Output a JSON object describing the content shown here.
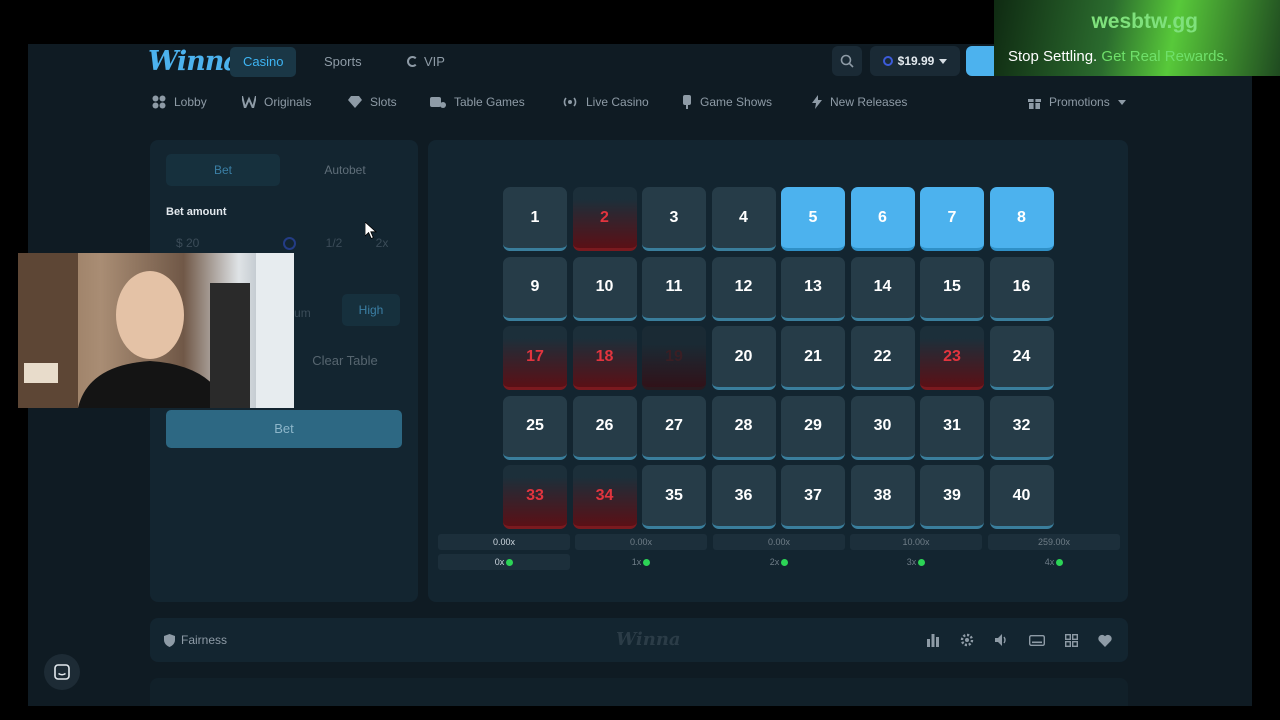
{
  "brand": {
    "logo": "Winna"
  },
  "nav": {
    "tabs": [
      {
        "label": "Casino",
        "active": true
      },
      {
        "label": "Sports",
        "active": false
      },
      {
        "label": "VIP",
        "active": false
      }
    ],
    "balance": "$19.99"
  },
  "categories": [
    {
      "label": "Lobby",
      "icon": "grid-icon"
    },
    {
      "label": "Originals",
      "icon": "originals-icon"
    },
    {
      "label": "Slots",
      "icon": "diamond-icon"
    },
    {
      "label": "Table Games",
      "icon": "table-icon"
    },
    {
      "label": "Live Casino",
      "icon": "live-icon"
    },
    {
      "label": "Game Shows",
      "icon": "mic-icon"
    },
    {
      "label": "New Releases",
      "icon": "bolt-icon"
    },
    {
      "label": "Promotions",
      "icon": "gift-icon"
    }
  ],
  "bet_panel": {
    "tabs": [
      {
        "label": "Bet",
        "active": true
      },
      {
        "label": "Autobet",
        "active": false
      }
    ],
    "amount_label": "Bet amount",
    "amount_value": "$ 20",
    "half": "1/2",
    "double": "2x",
    "risk_medium": "edium",
    "risk_high": "High",
    "clear_label": "Clear Table",
    "bet_label": "Bet"
  },
  "keno": {
    "tiles": [
      {
        "n": "1",
        "s": "normal"
      },
      {
        "n": "2",
        "s": "miss"
      },
      {
        "n": "3",
        "s": "normal"
      },
      {
        "n": "4",
        "s": "normal"
      },
      {
        "n": "5",
        "s": "picked"
      },
      {
        "n": "6",
        "s": "picked"
      },
      {
        "n": "7",
        "s": "picked"
      },
      {
        "n": "8",
        "s": "picked"
      },
      {
        "n": "9",
        "s": "normal"
      },
      {
        "n": "10",
        "s": "normal"
      },
      {
        "n": "11",
        "s": "normal"
      },
      {
        "n": "12",
        "s": "normal"
      },
      {
        "n": "13",
        "s": "normal"
      },
      {
        "n": "14",
        "s": "normal"
      },
      {
        "n": "15",
        "s": "normal"
      },
      {
        "n": "16",
        "s": "normal"
      },
      {
        "n": "17",
        "s": "miss"
      },
      {
        "n": "18",
        "s": "miss"
      },
      {
        "n": "19",
        "s": "faded"
      },
      {
        "n": "20",
        "s": "normal"
      },
      {
        "n": "21",
        "s": "normal"
      },
      {
        "n": "22",
        "s": "normal"
      },
      {
        "n": "23",
        "s": "miss"
      },
      {
        "n": "24",
        "s": "normal"
      },
      {
        "n": "25",
        "s": "normal"
      },
      {
        "n": "26",
        "s": "normal"
      },
      {
        "n": "27",
        "s": "normal"
      },
      {
        "n": "28",
        "s": "normal"
      },
      {
        "n": "29",
        "s": "normal"
      },
      {
        "n": "30",
        "s": "normal"
      },
      {
        "n": "31",
        "s": "normal"
      },
      {
        "n": "32",
        "s": "normal"
      },
      {
        "n": "33",
        "s": "miss"
      },
      {
        "n": "34",
        "s": "miss"
      },
      {
        "n": "35",
        "s": "normal"
      },
      {
        "n": "36",
        "s": "normal"
      },
      {
        "n": "37",
        "s": "normal"
      },
      {
        "n": "38",
        "s": "normal"
      },
      {
        "n": "39",
        "s": "normal"
      },
      {
        "n": "40",
        "s": "normal"
      }
    ],
    "payouts": [
      {
        "mult": "0.00x",
        "hits": "0x",
        "highlight": true
      },
      {
        "mult": "0.00x",
        "hits": "1x",
        "highlight": false
      },
      {
        "mult": "0.00x",
        "hits": "2x",
        "highlight": false
      },
      {
        "mult": "10.00x",
        "hits": "3x",
        "highlight": false
      },
      {
        "mult": "259.00x",
        "hits": "4x",
        "highlight": false
      }
    ]
  },
  "footer": {
    "fairness": "Fairness",
    "watermark": "Winna"
  },
  "overlay": {
    "site": "wesbtw.gg",
    "tagline_a": "Stop Settling. ",
    "tagline_b": "Get Real Rewards."
  },
  "colors": {
    "accent": "#4cb2ee",
    "miss": "#e2343e",
    "panel": "#132530",
    "background": "#0f1b23"
  }
}
